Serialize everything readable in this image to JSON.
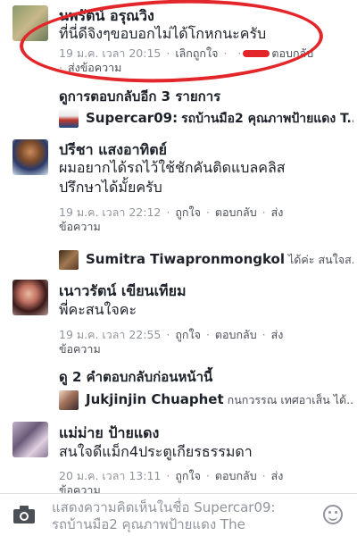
{
  "comments": [
    {
      "name": "นพรัตน์ อรุณวิง",
      "text_lines": [
        "ที่นี่ดีจิงๆขอบอกไม่ได้โกหกนะครับ"
      ],
      "meta_line1": {
        "time": "19 ม.ค. เวลา 20:15",
        "action1": "เลิกถูกใจ",
        "action2": "ตอบกลับ"
      },
      "meta_line2": "ส่งข้อความ"
    },
    {
      "name": "ปรีชา แสงอาทิตย์",
      "text_lines": [
        "ผมอยากได้รถไว้ใช้ชักคันติดแบลคลิส",
        "ปรึกษาได้มั้ยครับ"
      ],
      "meta_line1": {
        "time": "19 ม.ค. เวลา 22:12",
        "action1": "ถูกใจ",
        "action2": "ตอบกลับ",
        "action3": "ส่ง"
      },
      "meta_line2": "ข้อความ"
    },
    {
      "name": "เนาวรัตน์ เขียนเทียม",
      "text_lines": [
        "พี่คะสนใจคะ"
      ],
      "meta_line1": {
        "time": "19 ม.ค. เวลา 22:55",
        "action1": "ถูกใจ",
        "action2": "ตอบกลับ",
        "action3": "ส่ง"
      },
      "meta_line2": "ข้อความ"
    },
    {
      "name": "แม่ม่าย ป้ายแดง",
      "text_lines": [
        "สนใจดีแม็ก4ประตูเกียรธรรมดา"
      ],
      "meta_line1": {
        "time": "20 ม.ค. เวลา 13:11",
        "action1": "ถูกใจ",
        "action2": "ตอบกลับ",
        "action3": "ส่ง"
      },
      "meta_line2": "ข้อความ"
    }
  ],
  "more_replies_1": "ดูการตอบกลับอีก 3 รายการ",
  "reply_1": {
    "name": "Supercar09:",
    "text": "รถบ้านมือ2 คุณภาพป้ายแดง T..."
  },
  "reply_2": {
    "name": "Sumitra Tiwapronmongkol",
    "text": "ได้ค่ะ สนใจส..."
  },
  "more_replies_2": "ดู 2 คำตอบกลับก่อนหน้านี้",
  "reply_3": {
    "name": "Jukjinjin Chuaphet",
    "text": "กนกวรรณ เทศอาเส็น ได้..."
  },
  "composer": {
    "placeholder_line1": "แสดงความคิดเห็นในชื่อ Supercar09:",
    "placeholder_line2": "รถบ้านมือ2 คุณภาพป้ายแดง The"
  },
  "icons": {
    "camera": "camera-icon",
    "emoji": "emoji-icon"
  },
  "colors": {
    "annotation": "#e2262a",
    "meta": "#90949c",
    "text": "#1d2129"
  }
}
